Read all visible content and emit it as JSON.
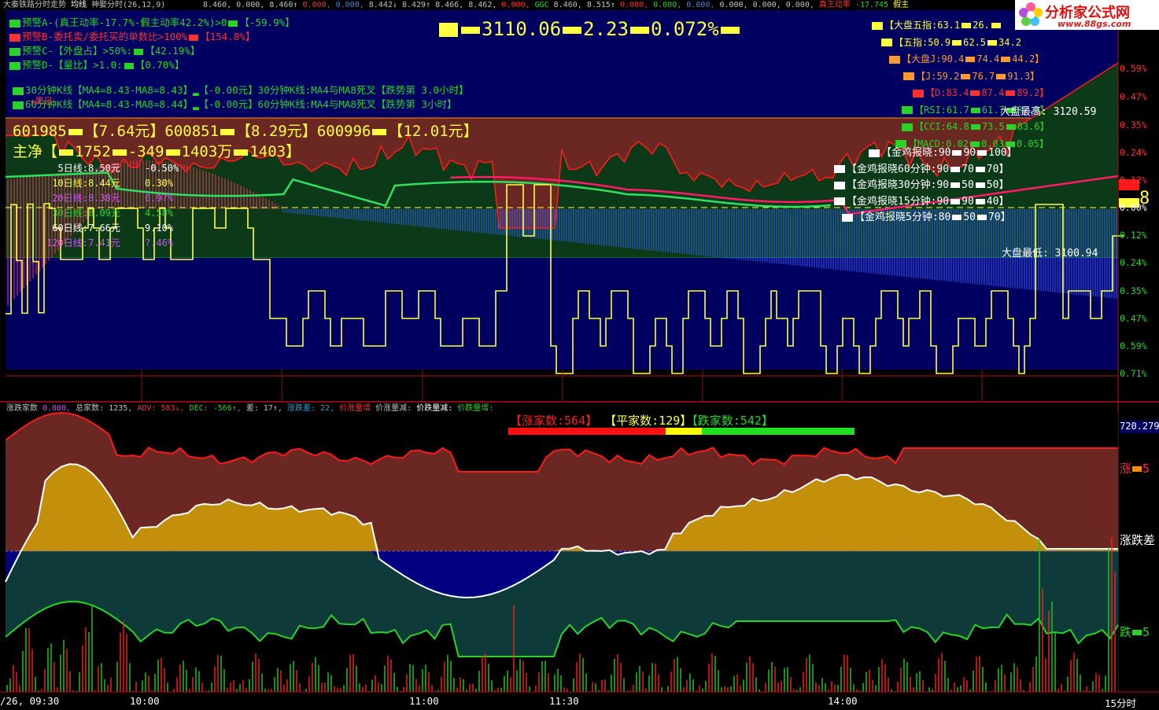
{
  "header": {
    "title": "大秦铁路分时走势",
    "avg_label": "均线",
    "indicator_name": "神娶分时(26,12,9)",
    "values": [
      "8.460,",
      "0.000,",
      "8.460↑",
      "0.000,",
      "0.000,",
      "8.442↓",
      "8.429↑",
      "8.466,",
      "8.462,",
      "0.000,",
      "GGC",
      "8.460,",
      "8.515↑",
      "0.000,",
      "0.000,",
      "0.000,",
      "0.000,",
      "0.000,",
      "0.000,",
      "真王动率",
      "-17.745",
      "假主"
    ]
  },
  "logo": {
    "text": "分析家公式网",
    "url": "www.88gs.com"
  },
  "alerts": [
    {
      "text": "预警A-(真王动率-17.7%-假主动率42.2%)>0",
      "value": "【-59.9%】",
      "color": "#27d427"
    },
    {
      "text": "预警B-委托卖/委托买的单数比>100%",
      "value": "【154.8%】",
      "color": "#ff3030"
    },
    {
      "text": "预警C-【外盘占】>50%:",
      "value": "【42.19%】",
      "color": "#27d427"
    },
    {
      "text": "预警D-【量比】>1.0:",
      "value": "【0.70%】",
      "color": "#27d427"
    }
  ],
  "kline_signals": [
    "30分钟K线【MA4=8.43-MA8=8.43】▂【-0.00元】30分钟K线:MA4与MA8死叉【跌势第 3.0小时】",
    "60分钟K线【MA4=8.43-MA8=8.44】▂【-0.00元】60分钟K线:MA4与MA8死叉【跌势第 3小时】"
  ],
  "index_quote": {
    "price": "3110.06",
    "change": "2.23",
    "pct": "0.072%"
  },
  "stocks_line": {
    "s1": "601985",
    "p1": "【7.64元】",
    "s2": "600851",
    "p2": "【8.29元】",
    "s3": "600996",
    "p3": "【12.01元】"
  },
  "main_net": {
    "label": "主净【",
    "v1": "1752",
    "v2": "-349",
    "v3": "1403万",
    "v4": "1403】"
  },
  "ma_table": [
    {
      "label": "5日线:",
      "value": "8.50元",
      "pct": "-0.50%",
      "color": "#ffffff"
    },
    {
      "label": "10日线:",
      "value": "8.44元",
      "pct": "0.30%",
      "color": "#ffff40"
    },
    {
      "label": "20日线:",
      "value": "8.38元",
      "pct": "0.9?%",
      "color": "#d050ff"
    },
    {
      "label": "30日线:",
      "value": "8.09元",
      "pct": "4.58%",
      "color": "#27d427"
    },
    {
      "label": "60日线:",
      "value": "7.66元",
      "pct": "9.10%",
      "color": "#ffffff"
    },
    {
      "label": "120日线:",
      "value": "7.41元",
      "pct": "?.46%",
      "color": "#d050ff"
    }
  ],
  "index_indicators": [
    {
      "label": "【大盘五指:63.1",
      "v2": "26.",
      "v3": "",
      "color": "#ffff40"
    },
    {
      "label": "【五指:50.9",
      "v2": "62.5",
      "v3": "34.2",
      "color": "#ffff40"
    },
    {
      "label": "【大盘J:90.4",
      "v2": "74.4",
      "v3": "44.2】",
      "color": "#ff9a30"
    },
    {
      "label": "【J:59.2",
      "v2": "76.7",
      "v3": "91.3】",
      "color": "#ff9a30"
    },
    {
      "label": "【D:83.4",
      "v2": "87.4",
      "v3": "89.2】",
      "color": "#ff3030"
    },
    {
      "label": "【RSI:61.7",
      "v2": "61.7",
      "v3": "??.0】",
      "color": "#27d427"
    },
    {
      "label": "【CCI:64.8",
      "v2": "73.5",
      "v3": "83.6】",
      "color": "#27d427"
    },
    {
      "label": "【MACD:0.02",
      "v2": "0.03",
      "v3": "0.05】",
      "color": "#27d427"
    }
  ],
  "golden_chicken": [
    {
      "label": "【金鸡报晓:90",
      "v2": "90",
      "v3": "100】"
    },
    {
      "label": "【金鸡报晓60分钟:90",
      "v2": "70",
      "v3": "70】"
    },
    {
      "label": "【金鸡报晓30分钟:90",
      "v2": "50",
      "v3": "50】"
    },
    {
      "label": "【金鸡报晓15分钟:90",
      "v2": "90",
      "v3": "40】"
    },
    {
      "label": "【金鸡报晓5分钟:80",
      "v2": "50",
      "v3": "70】"
    }
  ],
  "market_high": "大盘最高: 3120.59",
  "market_low": "大盘最低: 3100.94",
  "right_axis": [
    "0.59%",
    "0.47%",
    "0.35%",
    "0.24%",
    "0.12%",
    "0.00%",
    "0.12%",
    "0.24%",
    "0.35%",
    "0.47%",
    "0.59%",
    "0.71%"
  ],
  "right_tag": "8",
  "bottom_header": [
    {
      "text": "涨跌家数",
      "color": "#c0c0c0"
    },
    {
      "text": " 0.000,",
      "color": "#d050ff"
    },
    {
      "text": " 总家数: 1235,",
      "color": "#c0c0c0"
    },
    {
      "text": " ADV: 583↓,",
      "color": "#ff3030"
    },
    {
      "text": " DEC: -566↑,",
      "color": "#27d427"
    },
    {
      "text": " 差: 17↑,",
      "color": "#c0c0c0"
    },
    {
      "text": " 涨跌差: 22,",
      "color": "#30a0d0"
    },
    {
      "text": " 价涨量增",
      "color": "#ff3030"
    },
    {
      "text": "  价涨量减:",
      "color": "#c0c0c0"
    },
    {
      "text": " 价跌量减:",
      "color": "#ffffff"
    },
    {
      "text": " 价跌量增:",
      "color": "#27d427"
    }
  ],
  "breadth": {
    "up": "【涨家数:564】",
    "flat": "【平家数:129】",
    "down": "【跌家数:542】"
  },
  "bottom_axis": {
    "top_value": "720.279",
    "up_label": "涨",
    "diff_label": "涨跌差",
    "down_label": "跌",
    "up_num": "5",
    "down_num": "5"
  },
  "time_axis": [
    "/26, 09:30",
    "10:00",
    "11:00",
    "11:30",
    "14:00",
    "15分时"
  ],
  "colors": {
    "bg": "#000000",
    "navy": "#000060",
    "brown": "#6b2823",
    "up": "#ff2020",
    "down": "#27d427",
    "yellow": "#ffff40",
    "gold": "#c4900c"
  }
}
